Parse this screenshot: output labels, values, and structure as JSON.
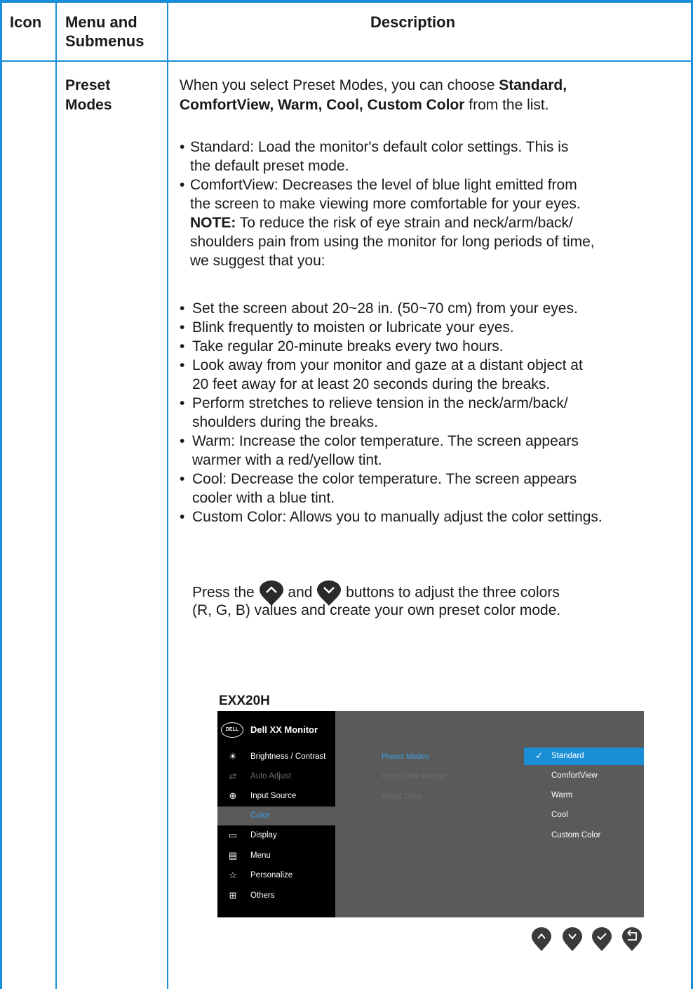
{
  "table": {
    "headers": {
      "icon": "Icon",
      "menu_line1": "Menu and",
      "menu_line2": "Submenus",
      "description": "Description"
    },
    "row": {
      "menu_line1": "Preset",
      "menu_line2": "Modes",
      "intro": {
        "l1_a": "When you select Preset Modes, you can choose ",
        "l1_b": "Standard,",
        "l2_a": "ComfortView, Warm, Cool, Custom Color",
        "l2_b": " from the list."
      },
      "bullets": {
        "standard_1": "Standard: Load the monitor's default color settings. This is",
        "standard_2": "the default preset mode.",
        "comfort_1": "ComfortView: Decreases the level of blue light emitted from",
        "comfort_2": "the screen to make viewing more comfortable for your eyes.",
        "note_label": "NOTE:",
        "note_1": " To reduce the risk of eye strain and neck/arm/back/",
        "note_2": "shoulders pain from using the monitor for long periods of time,",
        "note_3": "we suggest that you:",
        "tip1": "Set the screen about 20~28 in. (50~70 cm) from your eyes.",
        "tip2": "Blink frequently to moisten or lubricate your eyes.",
        "tip3": "Take regular 20-minute breaks every two hours.",
        "tip4_1": "Look away from your monitor and gaze at a distant object at",
        "tip4_2": "20 feet away for at least 20 seconds during the breaks.",
        "tip5_1": "Perform stretches to relieve tension in the neck/arm/back/",
        "tip5_2": "shoulders during the breaks.",
        "warm_1": "Warm: Increase the color temperature. The screen appears",
        "warm_2": "warmer with a red/yellow tint.",
        "cool_1": "Cool: Decrease the color temperature. The screen appears",
        "cool_2": "cooler with a blue tint.",
        "custom": "Custom Color: Allows you to manually adjust the color settings."
      },
      "press": {
        "a": "Press the",
        "b": "and",
        "c": "buttons to adjust the three colors",
        "l2": "(R, G, B) values and create your own preset color mode."
      }
    }
  },
  "osd": {
    "model": "EXX20H",
    "logo": "DELL",
    "title": "Dell XX Monitor",
    "menu": [
      {
        "icon": "brightness-icon",
        "label": "Brightness / Contrast"
      },
      {
        "icon": "auto-adjust-icon",
        "label": "Auto Adjust"
      },
      {
        "icon": "input-source-icon",
        "label": "Input Source"
      },
      {
        "icon": "color-icon",
        "label": "Color"
      },
      {
        "icon": "display-icon",
        "label": "Display"
      },
      {
        "icon": "menu-icon",
        "label": "Menu"
      },
      {
        "icon": "personalize-icon",
        "label": "Personalize"
      },
      {
        "icon": "others-icon",
        "label": "Others"
      }
    ],
    "submenu": [
      "Preset Modes",
      "Input Color Format",
      "Reset Color"
    ],
    "options": [
      "Standard",
      "ComfortView",
      "Warm",
      "Cool",
      "Custom Color"
    ],
    "colors": {
      "accent": "#1a8fd8",
      "border": "#1a8ed8",
      "osd_bg": "#5a5a5a"
    }
  }
}
